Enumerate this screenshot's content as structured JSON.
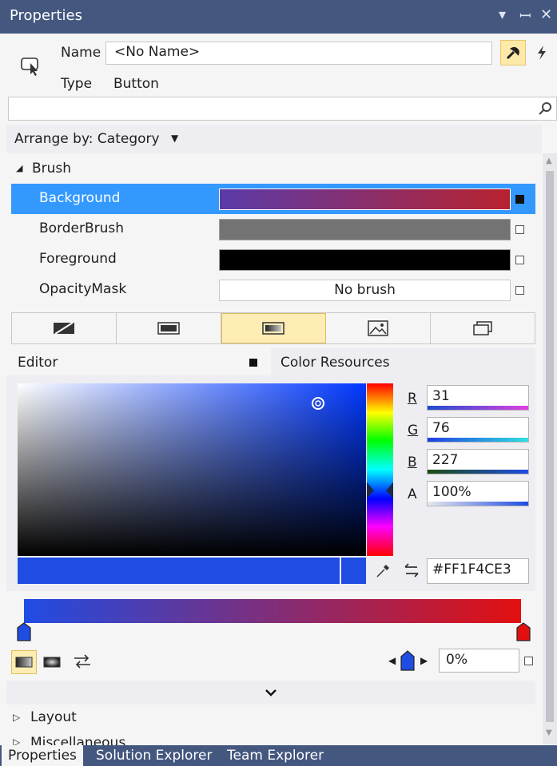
{
  "titlebar": {
    "title": "Properties",
    "dropdown_icon": "▾",
    "pin_icon": "ᴕ",
    "close_icon": "✕"
  },
  "header": {
    "name_label": "Name",
    "name_value": "<No Name>",
    "type_label": "Type",
    "type_value": "Button"
  },
  "search": {
    "placeholder": ""
  },
  "arrange": {
    "label": "Arrange by: Category"
  },
  "brush": {
    "category": "Brush",
    "rows": [
      {
        "name": "Background",
        "swatch": "linear-gradient(to right,#5a3aa8,#b8222e)",
        "selected": true
      },
      {
        "name": "BorderBrush",
        "swatch": "#737373",
        "selected": false
      },
      {
        "name": "Foreground",
        "swatch": "#000000",
        "selected": false
      },
      {
        "name": "OpacityMask",
        "value": "No brush",
        "selected": false
      }
    ]
  },
  "editor": {
    "tab_editor": "Editor",
    "tab_resources": "Color Resources",
    "r_label": "R",
    "r_value": "31",
    "g_label": "G",
    "g_value": "76",
    "b_label": "B",
    "b_value": "227",
    "a_label": "A",
    "a_value": "100%",
    "hex_value": "#FF1F4CE3"
  },
  "gradient": {
    "offset_value": "0%",
    "start_color": "#1f4ce3",
    "end_color": "#e31010"
  },
  "sections": {
    "layout": "Layout",
    "misc": "Miscellaneous"
  },
  "bottom_tabs": [
    "Properties",
    "Solution Explorer",
    "Team Explorer"
  ],
  "colors": {
    "accent": "#3399ff",
    "titlebar": "#43577f",
    "selected_color": "#1f4ce3"
  }
}
